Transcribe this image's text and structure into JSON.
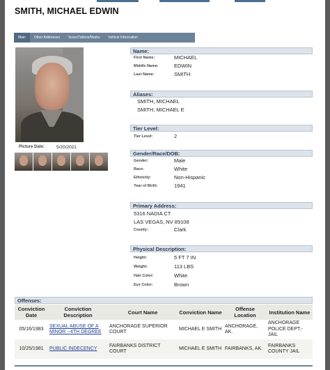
{
  "header": {
    "name": "SMITH, MICHAEL EDWIN"
  },
  "nav": {
    "tabs": [
      {
        "label": "Main"
      },
      {
        "label": "Other Addresses"
      },
      {
        "label": "Scars/Tattoos/Marks"
      },
      {
        "label": "Vehicle Information"
      }
    ]
  },
  "photo": {
    "date_label": "Picture Date:",
    "date": "5/20/2021"
  },
  "name_panel": {
    "title": "Name:",
    "first_label": "First Name:",
    "first": "MICHAEL",
    "middle_label": "Middle Name:",
    "middle": "EDWIN",
    "last_label": "Last Name:",
    "last": "SMITH"
  },
  "aliases": {
    "title": "Aliases:",
    "items": [
      "SMITH, MICHAEL",
      "SMITH, MICHAEL E"
    ]
  },
  "tier": {
    "title": "Tier Level:",
    "label": "Tier Level:",
    "value": "2"
  },
  "demo": {
    "title": "Gender/Race/DOB:",
    "gender_label": "Gender:",
    "gender": "Male",
    "race_label": "Race:",
    "race": "White",
    "ethnicity_label": "Ethnicity:",
    "ethnicity": "Non-Hispanic",
    "yob_label": "Year of Birth:",
    "yob": "1941"
  },
  "address": {
    "title": "Primary Address:",
    "line1": "5316 NADIA CT",
    "line2": "LAS VEGAS, NV 89108",
    "county_label": "County:",
    "county": "Clark"
  },
  "physical": {
    "title": "Physical Description:",
    "height_label": "Height:",
    "height": "5 FT 7 IN",
    "weight_label": "Weight:",
    "weight": "113 LBS",
    "hair_label": "Hair Color:",
    "hair": "White",
    "eye_label": "Eye Color:",
    "eye": "Brown"
  },
  "offenses": {
    "title": "Offenses:",
    "columns": [
      "Conviction Date",
      "Conviction Description",
      "Court Name",
      "Conviction Name",
      "Offense Location",
      "Institution Name"
    ],
    "rows": [
      [
        "05/16/1983",
        "SEXUAL ABUSE OF A MINOR --4TH DEGREE",
        "ANCHORAGE SUPERIOR COURT",
        "MICHAEL E SMITH",
        "ANCHORAGE, AK.",
        "ANCHORAGE POLICE DEPT.-JAIL"
      ],
      [
        "10/25/1981",
        "PUBLIC INDECENCY",
        "FAIRBANKS DISTRICT COURT",
        "MICHAEL E SMITH",
        "FAIRBANKS, AK.",
        "FAIRBANKS COUNTY JAIL"
      ]
    ]
  },
  "colors": {
    "nav_bg": "#6b8299",
    "panel_head_bg": "#dde3ea",
    "link": "#1f3f8f"
  }
}
